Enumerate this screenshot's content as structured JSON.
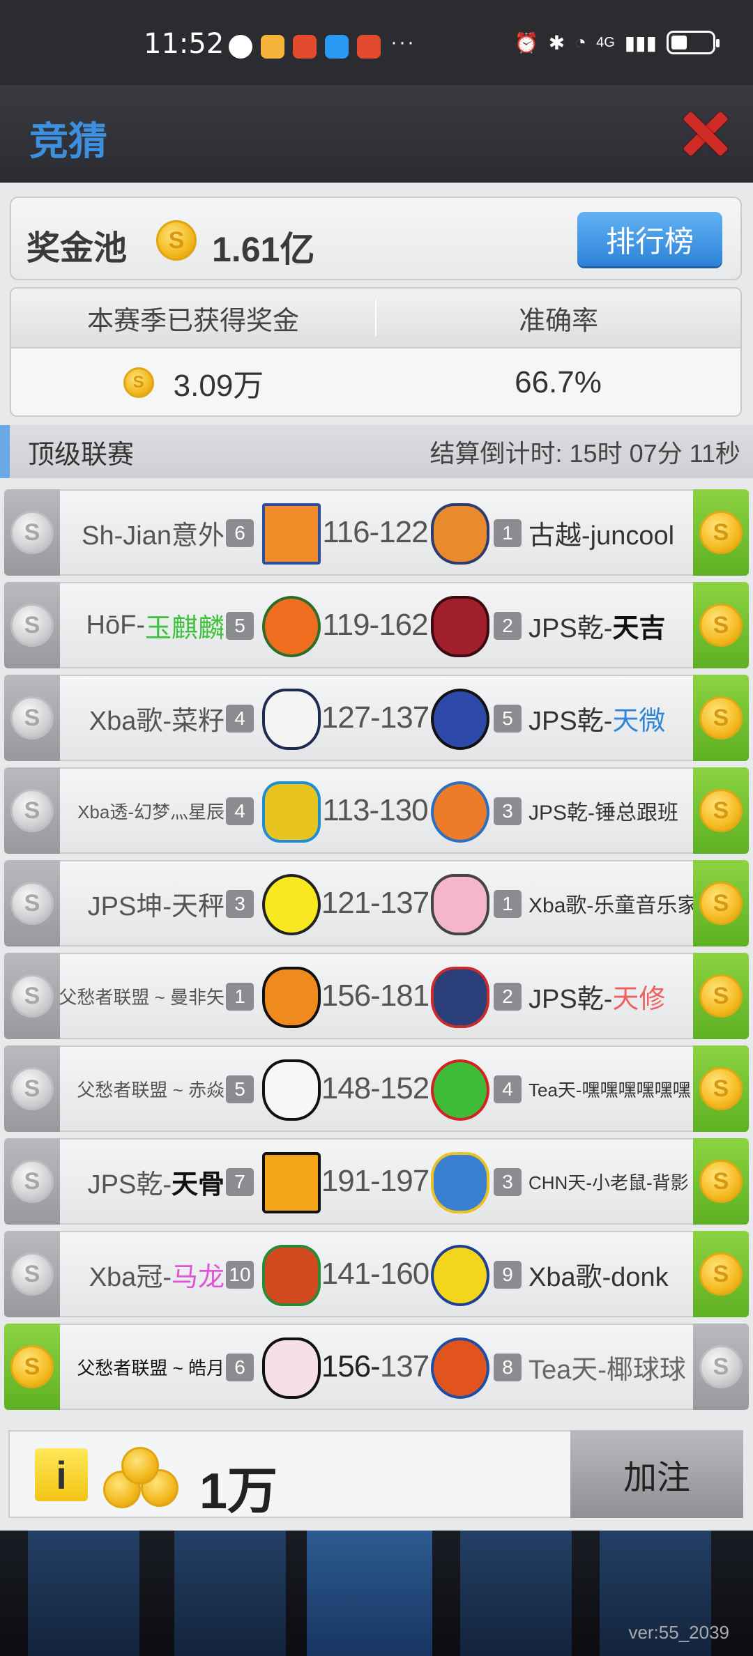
{
  "status_bar": {
    "time": "11:52",
    "network": "4G"
  },
  "header": {
    "title": "竞猜"
  },
  "pool": {
    "label": "奖金池",
    "coin": "S",
    "value": "1.61亿",
    "rank_button": "排行榜"
  },
  "stats": {
    "earned_label": "本赛季已获得奖金",
    "accuracy_label": "准确率",
    "earned_value": "3.09万",
    "accuracy_value": "66.7%"
  },
  "league": {
    "name": "顶级联赛",
    "countdown": "结算倒计时:  15时 07分 11秒"
  },
  "matches": [
    {
      "home_pre": "Sh-Jian意外",
      "home_post": "",
      "home_rank": "6",
      "score_home": "116",
      "score_away": "122",
      "away_rank": "1",
      "away_pre": "古越-juncool",
      "away_post": ""
    },
    {
      "home_pre": "HōF-",
      "home_post": "玉麒麟",
      "home_rank": "5",
      "score_home": "119",
      "score_away": "162",
      "away_rank": "2",
      "away_pre": "JPS乾-",
      "away_post": "天吉"
    },
    {
      "home_pre": "Xba歌-菜籽",
      "home_post": "",
      "home_rank": "4",
      "score_home": "127",
      "score_away": "137",
      "away_rank": "5",
      "away_pre": "JPS乾-",
      "away_post": "天微"
    },
    {
      "home_pre": "Xba透-幻梦灬星辰",
      "home_post": "",
      "home_rank": "4",
      "score_home": "113",
      "score_away": "130",
      "away_rank": "3",
      "away_pre": "JPS乾-锤总跟班",
      "away_post": ""
    },
    {
      "home_pre": "JPS坤-天秤",
      "home_post": "",
      "home_rank": "3",
      "score_home": "121",
      "score_away": "137",
      "away_rank": "1",
      "away_pre": "Xba歌-乐童音乐家",
      "away_post": ""
    },
    {
      "home_pre": "父愁者联盟 ~ 曼非矢",
      "home_post": "",
      "home_rank": "1",
      "score_home": "156",
      "score_away": "181",
      "away_rank": "2",
      "away_pre": "JPS乾-",
      "away_post": "天修"
    },
    {
      "home_pre": "父愁者联盟 ~ 赤焱",
      "home_post": "",
      "home_rank": "5",
      "score_home": "148",
      "score_away": "152",
      "away_rank": "4",
      "away_pre": "Tea天-嘿嘿嘿嘿嘿嘿",
      "away_post": ""
    },
    {
      "home_pre": "JPS乾-",
      "home_post": "天骨",
      "home_rank": "7",
      "score_home": "191",
      "score_away": "197",
      "away_rank": "3",
      "away_pre": "CHN天-小老鼠-背影",
      "away_post": ""
    },
    {
      "home_pre": "Xba冠-",
      "home_post": "马龙",
      "home_rank": "10",
      "score_home": "141",
      "score_away": "160",
      "away_rank": "9",
      "away_pre": "Xba歌-donk",
      "away_post": ""
    },
    {
      "home_pre": "父愁者联盟 ~ 皓月",
      "home_post": "",
      "home_rank": "6",
      "score_home": "156",
      "score_away": "137",
      "away_rank": "8",
      "away_pre": "Tea天-椰球球",
      "away_post": ""
    }
  ],
  "bet": {
    "info_icon": "i",
    "amount": "1万",
    "button": "加注"
  },
  "footer": {
    "version": "ver:55_2039"
  },
  "colors": {
    "accent_blue": "#3d8fe0",
    "close_red": "#d12b27",
    "bet_green": "#6cbd2c",
    "coin_gold": "#f3b81e"
  }
}
